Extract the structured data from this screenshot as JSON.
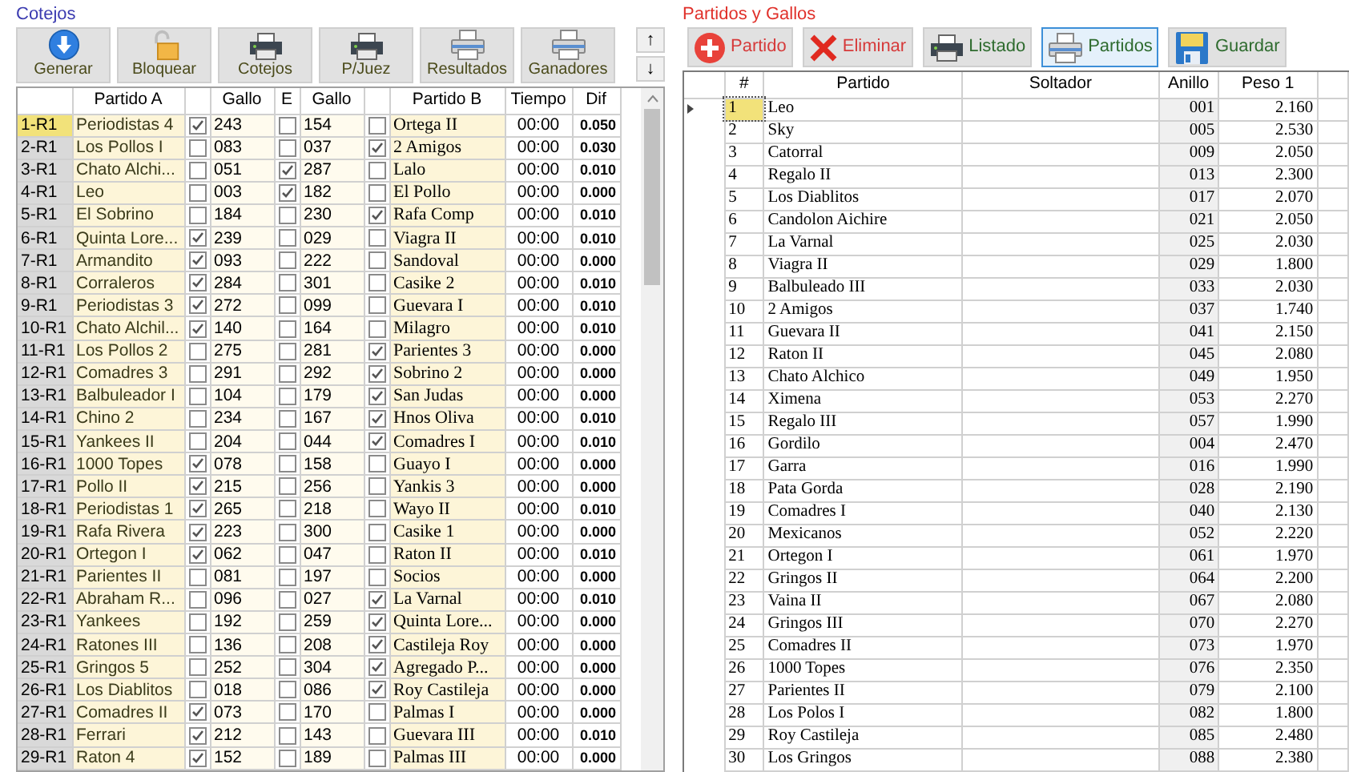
{
  "cotejos": {
    "title": "Cotejos",
    "toolbar": [
      {
        "label": "Generar",
        "kind": "download"
      },
      {
        "label": "Bloquear",
        "kind": "lock"
      },
      {
        "label": "Cotejos",
        "kind": "printer-color"
      },
      {
        "label": "P/Juez",
        "kind": "printer-color"
      },
      {
        "label": "Resultados",
        "kind": "printer"
      },
      {
        "label": "Ganadores",
        "kind": "printer"
      }
    ],
    "scroll_buttons": [
      "↑",
      "↓"
    ],
    "headers": {
      "partido_a": "Partido A",
      "gallo_a": "Gallo",
      "e": "E",
      "gallo_b": "Gallo",
      "partido_b": "Partido B",
      "tiempo": "Tiempo",
      "dif": "Dif"
    },
    "rows": [
      {
        "id": "1-R1",
        "selected": true,
        "partido_a": "Periodistas 4",
        "a_checked": true,
        "gallo_a": "243",
        "e_checked": false,
        "gallo_b": "154",
        "b_checked": false,
        "partido_b": "Ortega II",
        "tiempo": "00:00",
        "dif": "0.050"
      },
      {
        "id": "2-R1",
        "selected": false,
        "partido_a": "Los Pollos I",
        "a_checked": false,
        "gallo_a": "083",
        "e_checked": false,
        "gallo_b": "037",
        "b_checked": true,
        "partido_b": "2 Amigos",
        "tiempo": "00:00",
        "dif": "0.030"
      },
      {
        "id": "3-R1",
        "selected": false,
        "partido_a": "Chato Alchi...",
        "a_checked": false,
        "gallo_a": "051",
        "e_checked": true,
        "gallo_b": "287",
        "b_checked": false,
        "partido_b": "Lalo",
        "tiempo": "00:00",
        "dif": "0.010"
      },
      {
        "id": "4-R1",
        "selected": false,
        "partido_a": "Leo",
        "a_checked": false,
        "gallo_a": "003",
        "e_checked": true,
        "gallo_b": "182",
        "b_checked": false,
        "partido_b": "El Pollo",
        "tiempo": "00:00",
        "dif": "0.000"
      },
      {
        "id": "5-R1",
        "selected": false,
        "partido_a": "El Sobrino",
        "a_checked": false,
        "gallo_a": "184",
        "e_checked": false,
        "gallo_b": "230",
        "b_checked": true,
        "partido_b": "Rafa Comp",
        "tiempo": "00:00",
        "dif": "0.010"
      },
      {
        "id": "6-R1",
        "selected": false,
        "partido_a": "Quinta Lore...",
        "a_checked": true,
        "gallo_a": "239",
        "e_checked": false,
        "gallo_b": "029",
        "b_checked": false,
        "partido_b": "Viagra II",
        "tiempo": "00:00",
        "dif": "0.010"
      },
      {
        "id": "7-R1",
        "selected": false,
        "partido_a": "Armandito",
        "a_checked": true,
        "gallo_a": "093",
        "e_checked": false,
        "gallo_b": "222",
        "b_checked": false,
        "partido_b": "Sandoval",
        "tiempo": "00:00",
        "dif": "0.000"
      },
      {
        "id": "8-R1",
        "selected": false,
        "partido_a": "Corraleros",
        "a_checked": true,
        "gallo_a": "284",
        "e_checked": false,
        "gallo_b": "301",
        "b_checked": false,
        "partido_b": "Casike 2",
        "tiempo": "00:00",
        "dif": "0.010"
      },
      {
        "id": "9-R1",
        "selected": false,
        "partido_a": "Periodistas 3",
        "a_checked": true,
        "gallo_a": "272",
        "e_checked": false,
        "gallo_b": "099",
        "b_checked": false,
        "partido_b": "Guevara I",
        "tiempo": "00:00",
        "dif": "0.010"
      },
      {
        "id": "10-R1",
        "selected": false,
        "partido_a": "Chato Alchil...",
        "a_checked": true,
        "gallo_a": "140",
        "e_checked": false,
        "gallo_b": "164",
        "b_checked": false,
        "partido_b": "Milagro",
        "tiempo": "00:00",
        "dif": "0.010"
      },
      {
        "id": "11-R1",
        "selected": false,
        "partido_a": "Los Pollos 2",
        "a_checked": false,
        "gallo_a": "275",
        "e_checked": false,
        "gallo_b": "281",
        "b_checked": true,
        "partido_b": "Parientes 3",
        "tiempo": "00:00",
        "dif": "0.000"
      },
      {
        "id": "12-R1",
        "selected": false,
        "partido_a": "Comadres 3",
        "a_checked": false,
        "gallo_a": "291",
        "e_checked": false,
        "gallo_b": "292",
        "b_checked": true,
        "partido_b": "Sobrino 2",
        "tiempo": "00:00",
        "dif": "0.000"
      },
      {
        "id": "13-R1",
        "selected": false,
        "partido_a": "Balbuleador I",
        "a_checked": false,
        "gallo_a": "104",
        "e_checked": false,
        "gallo_b": "179",
        "b_checked": true,
        "partido_b": "San Judas",
        "tiempo": "00:00",
        "dif": "0.000"
      },
      {
        "id": "14-R1",
        "selected": false,
        "partido_a": "Chino 2",
        "a_checked": false,
        "gallo_a": "234",
        "e_checked": false,
        "gallo_b": "167",
        "b_checked": true,
        "partido_b": "Hnos Oliva",
        "tiempo": "00:00",
        "dif": "0.010"
      },
      {
        "id": "15-R1",
        "selected": false,
        "partido_a": "Yankees II",
        "a_checked": false,
        "gallo_a": "204",
        "e_checked": false,
        "gallo_b": "044",
        "b_checked": true,
        "partido_b": "Comadres I",
        "tiempo": "00:00",
        "dif": "0.010"
      },
      {
        "id": "16-R1",
        "selected": false,
        "partido_a": "1000 Topes",
        "a_checked": true,
        "gallo_a": "078",
        "e_checked": false,
        "gallo_b": "158",
        "b_checked": false,
        "partido_b": "Guayo I",
        "tiempo": "00:00",
        "dif": "0.000"
      },
      {
        "id": "17-R1",
        "selected": false,
        "partido_a": "Pollo II",
        "a_checked": true,
        "gallo_a": "215",
        "e_checked": false,
        "gallo_b": "256",
        "b_checked": false,
        "partido_b": "Yankis 3",
        "tiempo": "00:00",
        "dif": "0.000"
      },
      {
        "id": "18-R1",
        "selected": false,
        "partido_a": "Periodistas 1",
        "a_checked": true,
        "gallo_a": "265",
        "e_checked": false,
        "gallo_b": "218",
        "b_checked": false,
        "partido_b": "Wayo II",
        "tiempo": "00:00",
        "dif": "0.010"
      },
      {
        "id": "19-R1",
        "selected": false,
        "partido_a": "Rafa Rivera",
        "a_checked": true,
        "gallo_a": "223",
        "e_checked": false,
        "gallo_b": "300",
        "b_checked": false,
        "partido_b": "Casike 1",
        "tiempo": "00:00",
        "dif": "0.000"
      },
      {
        "id": "20-R1",
        "selected": false,
        "partido_a": "Ortegon I",
        "a_checked": true,
        "gallo_a": "062",
        "e_checked": false,
        "gallo_b": "047",
        "b_checked": false,
        "partido_b": "Raton II",
        "tiempo": "00:00",
        "dif": "0.010"
      },
      {
        "id": "21-R1",
        "selected": false,
        "partido_a": "Parientes II",
        "a_checked": false,
        "gallo_a": "081",
        "e_checked": false,
        "gallo_b": "197",
        "b_checked": false,
        "partido_b": "Socios",
        "tiempo": "00:00",
        "dif": "0.000"
      },
      {
        "id": "22-R1",
        "selected": false,
        "partido_a": "Abraham R...",
        "a_checked": false,
        "gallo_a": "096",
        "e_checked": false,
        "gallo_b": "027",
        "b_checked": true,
        "partido_b": "La Varnal",
        "tiempo": "00:00",
        "dif": "0.010"
      },
      {
        "id": "23-R1",
        "selected": false,
        "partido_a": "Yankees",
        "a_checked": false,
        "gallo_a": "192",
        "e_checked": false,
        "gallo_b": "259",
        "b_checked": true,
        "partido_b": "Quinta Lore...",
        "tiempo": "00:00",
        "dif": "0.000"
      },
      {
        "id": "24-R1",
        "selected": false,
        "partido_a": "Ratones III",
        "a_checked": false,
        "gallo_a": "136",
        "e_checked": false,
        "gallo_b": "208",
        "b_checked": true,
        "partido_b": "Castileja Roy",
        "tiempo": "00:00",
        "dif": "0.000"
      },
      {
        "id": "25-R1",
        "selected": false,
        "partido_a": "Gringos 5",
        "a_checked": false,
        "gallo_a": "252",
        "e_checked": false,
        "gallo_b": "304",
        "b_checked": true,
        "partido_b": "Agregado P...",
        "tiempo": "00:00",
        "dif": "0.000"
      },
      {
        "id": "26-R1",
        "selected": false,
        "partido_a": "Los Diablitos",
        "a_checked": false,
        "gallo_a": "018",
        "e_checked": false,
        "gallo_b": "086",
        "b_checked": true,
        "partido_b": "Roy Castileja",
        "tiempo": "00:00",
        "dif": "0.000"
      },
      {
        "id": "27-R1",
        "selected": false,
        "partido_a": "Comadres II",
        "a_checked": true,
        "gallo_a": "073",
        "e_checked": false,
        "gallo_b": "170",
        "b_checked": false,
        "partido_b": "Palmas I",
        "tiempo": "00:00",
        "dif": "0.000"
      },
      {
        "id": "28-R1",
        "selected": false,
        "partido_a": "Ferrari",
        "a_checked": true,
        "gallo_a": "212",
        "e_checked": false,
        "gallo_b": "143",
        "b_checked": false,
        "partido_b": "Guevara III",
        "tiempo": "00:00",
        "dif": "0.010"
      },
      {
        "id": "29-R1",
        "selected": false,
        "partido_a": "Raton 4",
        "a_checked": true,
        "gallo_a": "152",
        "e_checked": false,
        "gallo_b": "189",
        "b_checked": false,
        "partido_b": "Palmas III",
        "tiempo": "00:00",
        "dif": "0.000"
      }
    ]
  },
  "partidos": {
    "title": "Partidos y Gallos",
    "toolbar": [
      {
        "label": "Partido",
        "kind": "add",
        "selected": false
      },
      {
        "label": "Eliminar",
        "kind": "delete",
        "selected": false
      },
      {
        "label": "Listado",
        "kind": "printer-color",
        "selected": false
      },
      {
        "label": "Partidos",
        "kind": "printer",
        "selected": true
      },
      {
        "label": "Guardar",
        "kind": "save",
        "selected": false
      }
    ],
    "headers": {
      "n": "#",
      "partido": "Partido",
      "soltador": "Soltador",
      "anillo": "Anillo",
      "peso_1": "Peso 1"
    },
    "rows": [
      {
        "n": "1",
        "selected": true,
        "partido": "Leo",
        "anillo": "001",
        "peso_1": "2.160"
      },
      {
        "n": "2",
        "selected": false,
        "partido": "Sky",
        "anillo": "005",
        "peso_1": "2.530"
      },
      {
        "n": "3",
        "selected": false,
        "partido": "Catorral",
        "anillo": "009",
        "peso_1": "2.050"
      },
      {
        "n": "4",
        "selected": false,
        "partido": "Regalo II",
        "anillo": "013",
        "peso_1": "2.300"
      },
      {
        "n": "5",
        "selected": false,
        "partido": "Los Diablitos",
        "anillo": "017",
        "peso_1": "2.070"
      },
      {
        "n": "6",
        "selected": false,
        "partido": "Candolon Aichire",
        "anillo": "021",
        "peso_1": "2.050"
      },
      {
        "n": "7",
        "selected": false,
        "partido": "La Varnal",
        "anillo": "025",
        "peso_1": "2.030"
      },
      {
        "n": "8",
        "selected": false,
        "partido": "Viagra II",
        "anillo": "029",
        "peso_1": "1.800"
      },
      {
        "n": "9",
        "selected": false,
        "partido": "Balbuleado III",
        "anillo": "033",
        "peso_1": "2.030"
      },
      {
        "n": "10",
        "selected": false,
        "partido": "2 Amigos",
        "anillo": "037",
        "peso_1": "1.740"
      },
      {
        "n": "11",
        "selected": false,
        "partido": "Guevara II",
        "anillo": "041",
        "peso_1": "2.150"
      },
      {
        "n": "12",
        "selected": false,
        "partido": "Raton II",
        "anillo": "045",
        "peso_1": "2.080"
      },
      {
        "n": "13",
        "selected": false,
        "partido": "Chato Alchico",
        "anillo": "049",
        "peso_1": "1.950"
      },
      {
        "n": "14",
        "selected": false,
        "partido": "Ximena",
        "anillo": "053",
        "peso_1": "2.270"
      },
      {
        "n": "15",
        "selected": false,
        "partido": "Regalo III",
        "anillo": "057",
        "peso_1": "1.990"
      },
      {
        "n": "16",
        "selected": false,
        "partido": "Gordilo",
        "anillo": "004",
        "peso_1": "2.470"
      },
      {
        "n": "17",
        "selected": false,
        "partido": "Garra",
        "anillo": "016",
        "peso_1": "1.990"
      },
      {
        "n": "18",
        "selected": false,
        "partido": "Pata Gorda",
        "anillo": "028",
        "peso_1": "2.190"
      },
      {
        "n": "19",
        "selected": false,
        "partido": "Comadres I",
        "anillo": "040",
        "peso_1": "2.130"
      },
      {
        "n": "20",
        "selected": false,
        "partido": "Mexicanos",
        "anillo": "052",
        "peso_1": "2.220"
      },
      {
        "n": "21",
        "selected": false,
        "partido": "Ortegon I",
        "anillo": "061",
        "peso_1": "1.970"
      },
      {
        "n": "22",
        "selected": false,
        "partido": "Gringos II",
        "anillo": "064",
        "peso_1": "2.200"
      },
      {
        "n": "23",
        "selected": false,
        "partido": "Vaina II",
        "anillo": "067",
        "peso_1": "2.080"
      },
      {
        "n": "24",
        "selected": false,
        "partido": "Gringos III",
        "anillo": "070",
        "peso_1": "2.270"
      },
      {
        "n": "25",
        "selected": false,
        "partido": "Comadres II",
        "anillo": "073",
        "peso_1": "1.970"
      },
      {
        "n": "26",
        "selected": false,
        "partido": "1000 Topes",
        "anillo": "076",
        "peso_1": "2.350"
      },
      {
        "n": "27",
        "selected": false,
        "partido": "Parientes II",
        "anillo": "079",
        "peso_1": "2.100"
      },
      {
        "n": "28",
        "selected": false,
        "partido": "Los Polos I",
        "anillo": "082",
        "peso_1": "1.800"
      },
      {
        "n": "29",
        "selected": false,
        "partido": "Roy Castileja",
        "anillo": "085",
        "peso_1": "2.480"
      },
      {
        "n": "30",
        "selected": false,
        "partido": "Los Gringos",
        "anillo": "088",
        "peso_1": "2.380"
      }
    ]
  }
}
